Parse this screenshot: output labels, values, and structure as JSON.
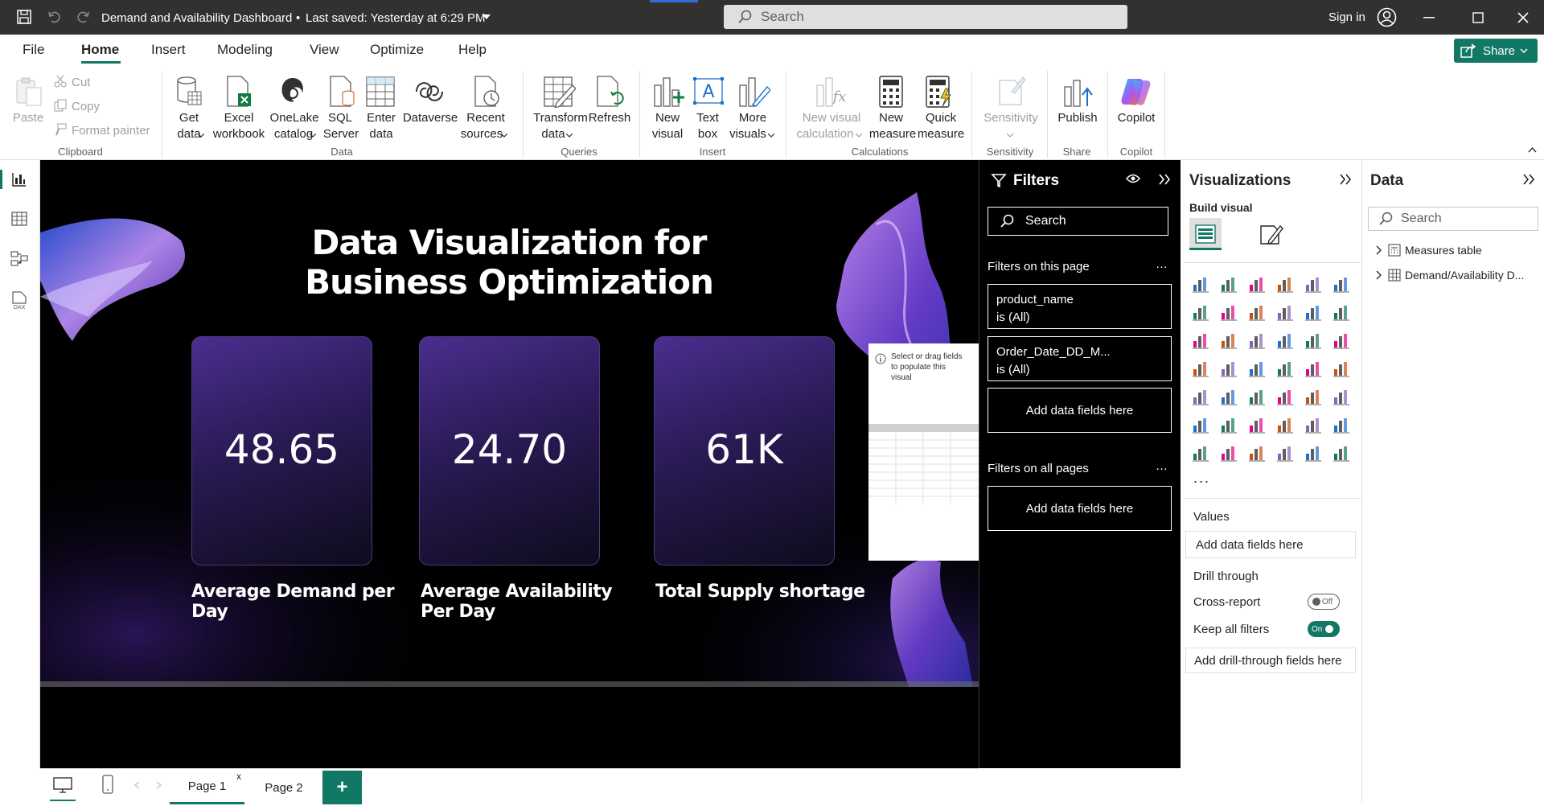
{
  "titlebar": {
    "title": "Demand and Availability Dashboard",
    "saved": "Last saved: Yesterday at 6:29 PM",
    "search_placeholder": "Search",
    "sign_in": "Sign in"
  },
  "menu": [
    "File",
    "Home",
    "Insert",
    "Modeling",
    "View",
    "Optimize",
    "Help"
  ],
  "share_label": "Share",
  "ribbon": {
    "clipboard": {
      "paste": "Paste",
      "cut": "Cut",
      "copy": "Copy",
      "format_painter": "Format painter",
      "label": "Clipboard"
    },
    "data": {
      "get_data": "Get",
      "get_data2": "data",
      "excel": "Excel",
      "excel2": "workbook",
      "onelake": "OneLake",
      "onelake2": "catalog",
      "sql": "SQL",
      "sql2": "Server",
      "enter": "Enter",
      "enter2": "data",
      "dataverse": "Dataverse",
      "recent": "Recent",
      "recent2": "sources",
      "label": "Data"
    },
    "queries": {
      "transform": "Transform",
      "transform2": "data",
      "refresh": "Refresh",
      "label": "Queries"
    },
    "insert": {
      "new_visual": "New",
      "new_visual2": "visual",
      "text_box": "Text",
      "text_box2": "box",
      "more": "More",
      "more2": "visuals",
      "label": "Insert"
    },
    "calculations": {
      "new_calc": "New visual",
      "new_calc2": "calculation",
      "new_measure": "New",
      "new_measure2": "measure",
      "quick": "Quick",
      "quick2": "measure",
      "label": "Calculations"
    },
    "sensitivity": {
      "btn": "Sensitivity",
      "label": "Sensitivity"
    },
    "share": {
      "publish": "Publish",
      "label": "Share"
    },
    "copilot": {
      "btn": "Copilot",
      "label": "Copilot"
    }
  },
  "report": {
    "title_line1": "Data Visualization for",
    "title_line2": "Business Optimization",
    "cards": [
      {
        "value": "48.65",
        "label1": "Average Demand per",
        "label2": "Day"
      },
      {
        "value": "24.70",
        "label1": "Average Availability",
        "label2": "Per Day"
      },
      {
        "value": "61K",
        "label1": "Total Supply shortage",
        "label2": ""
      }
    ],
    "placeholder_text1": "Select or drag fields",
    "placeholder_text2": "to populate this",
    "placeholder_text3": "visual"
  },
  "filters": {
    "title": "Filters",
    "search": "Search",
    "on_this_page": "Filters on this page",
    "items": [
      {
        "field": "product_name",
        "state": "is (All)"
      },
      {
        "field": "Order_Date_DD_M...",
        "state": "is (All)"
      }
    ],
    "add_fields": "Add data fields here",
    "on_all_pages": "Filters on all pages",
    "add_fields_all": "Add data fields here"
  },
  "visualizations": {
    "title": "Visualizations",
    "build_visual": "Build visual",
    "values": "Values",
    "add_fields": "Add data fields here",
    "drill_through": "Drill through",
    "cross_report": "Cross-report",
    "cross_report_state": "Off",
    "keep_filters": "Keep all filters",
    "keep_filters_state": "On",
    "add_drill": "Add drill-through fields here",
    "more": "..."
  },
  "data_pane": {
    "title": "Data",
    "search": "Search",
    "tables": [
      "Measures table",
      "Demand/Availability D..."
    ]
  },
  "pages": {
    "tabs": [
      "Page 1",
      "Page 2"
    ],
    "add": "+",
    "close": "x"
  },
  "colors": {
    "accent_green": "#117865",
    "dark": "#323130",
    "card_purple": "#4b2e8f"
  }
}
